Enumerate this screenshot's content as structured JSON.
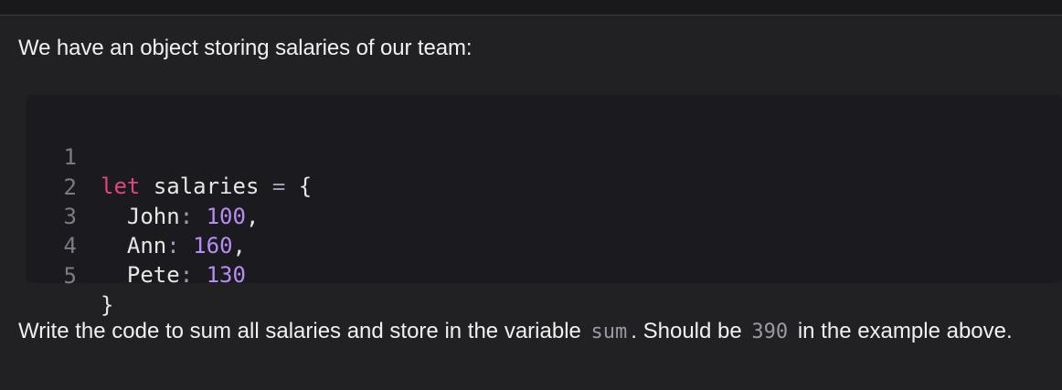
{
  "intro_text": "We have an object storing salaries of our team:",
  "code": {
    "line_numbers": [
      "1",
      "2",
      "3",
      "4",
      "5"
    ],
    "line1": {
      "keyword": "let",
      "name": "salaries",
      "op": "=",
      "brace": "{"
    },
    "line2": {
      "key": "John",
      "colon": ":",
      "value": "100",
      "comma": ","
    },
    "line3": {
      "key": "Ann",
      "colon": ":",
      "value": "160",
      "comma": ","
    },
    "line4": {
      "key": "Pete",
      "colon": ":",
      "value": "130"
    },
    "line5": {
      "brace": "}"
    }
  },
  "task": {
    "part1": "Write the code to sum all salaries and store in the variable",
    "code1": "sum",
    "part2": ". Should be",
    "code2": "390",
    "part3": "in the example above."
  },
  "colors": {
    "background": "#212124",
    "code_background": "#1b1b1f",
    "keyword": "#e0457b",
    "number": "#b98cf5",
    "line_number": "#7c7c86"
  }
}
